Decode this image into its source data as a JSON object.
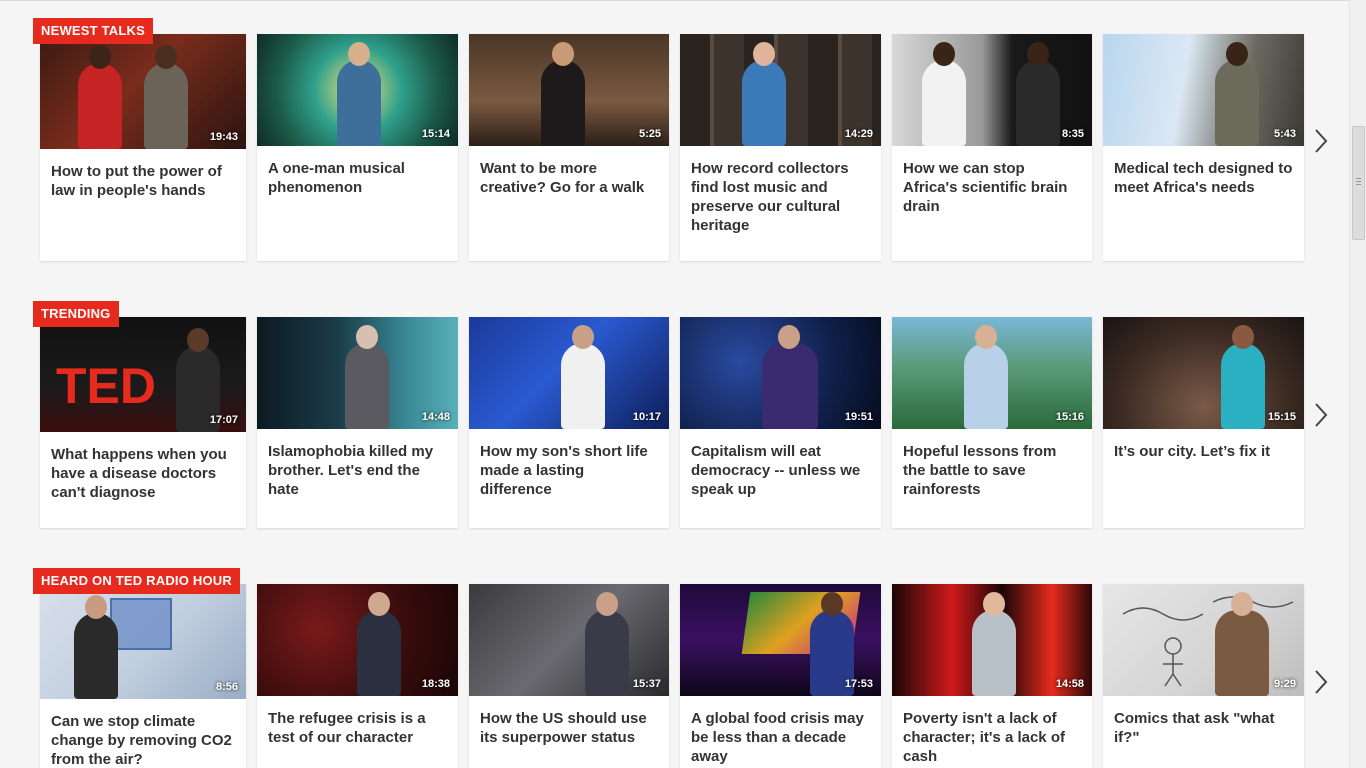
{
  "sections": [
    {
      "label": "NEWEST TALKS",
      "talks": [
        {
          "title": "How to put the power of law in people's hands",
          "duration": "19:43"
        },
        {
          "title": "A one-man musical phenomenon",
          "duration": "15:14"
        },
        {
          "title": "Want to be more creative? Go for a walk",
          "duration": "5:25"
        },
        {
          "title": "How record collectors find lost music and preserve our cultural heritage",
          "duration": "14:29"
        },
        {
          "title": "How we can stop Africa's scientific brain drain",
          "duration": "8:35"
        },
        {
          "title": "Medical tech designed to meet Africa's needs",
          "duration": "5:43"
        }
      ]
    },
    {
      "label": "TRENDING",
      "talks": [
        {
          "title": "What happens when you have a disease doctors can't diagnose",
          "duration": "17:07"
        },
        {
          "title": "Islamophobia killed my brother. Let's end the hate",
          "duration": "14:48"
        },
        {
          "title": "How my son's short life made a lasting difference",
          "duration": "10:17"
        },
        {
          "title": "Capitalism will eat democracy -- unless we speak up",
          "duration": "19:51"
        },
        {
          "title": "Hopeful lessons from the battle to save rainforests",
          "duration": "15:16"
        },
        {
          "title": "It’s our city. Let’s fix it",
          "duration": "15:15"
        }
      ]
    },
    {
      "label": "HEARD ON TED RADIO HOUR",
      "talks": [
        {
          "title": "Can we stop climate change by removing CO2 from the air?",
          "duration": "8:56"
        },
        {
          "title": "The refugee crisis is a test of our character",
          "duration": "18:38"
        },
        {
          "title": "How the US should use its superpower status",
          "duration": "15:37"
        },
        {
          "title": "A global food crisis may be less than a decade away",
          "duration": "17:53"
        },
        {
          "title": "Poverty isn't a lack of character; it's a lack of cash",
          "duration": "14:58"
        },
        {
          "title": "Comics that ask \"what if?\"",
          "duration": "9:29"
        }
      ]
    }
  ],
  "icons": {
    "next": "chevron-right-icon"
  },
  "colors": {
    "accent": "#e62b1e",
    "background": "#f5f5f5",
    "card": "#ffffff",
    "title_text": "#333333"
  }
}
